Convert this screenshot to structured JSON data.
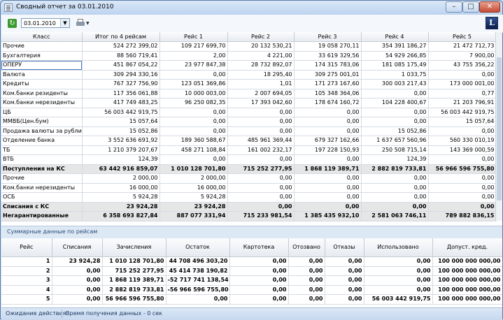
{
  "window": {
    "title": "Сводный отчет за  03.01.2010",
    "min_label": "–",
    "max_label": "□",
    "close_label": "✕"
  },
  "toolbar": {
    "date": "03.01.2010",
    "logo": "L"
  },
  "main": {
    "headers": [
      "Класс",
      "Итог по 4 рейсам",
      "Рейс 1",
      "Рейс 2",
      "Рейс 3",
      "Рейс 4",
      "Рейс 5"
    ],
    "rows": [
      {
        "c": [
          "Прочие",
          "524 272 399,02",
          "109 217 699,70",
          "20 132 530,21",
          "19 058 270,11",
          "354 391 186,27",
          "21 472 712,73"
        ]
      },
      {
        "c": [
          "Бухгалтерия",
          "88 560 719,41",
          "2,00",
          "4 221,00",
          "33 619 329,56",
          "54 929 266,85",
          "7 900,00"
        ]
      },
      {
        "c": [
          "ОПЕРУ",
          "451 867 054,22",
          "23 977 847,38",
          "28 732 892,07",
          "174 315 783,06",
          "181 085 175,49",
          "43 755 356,22"
        ],
        "sel": true
      },
      {
        "c": [
          "Валюта",
          "309 294 330,16",
          "0,00",
          "18 295,40",
          "309 275 001,01",
          "1 033,75",
          "0,00"
        ]
      },
      {
        "c": [
          "Кредиты",
          "767 327 756,90",
          "123 051 369,86",
          "1,01",
          "171 273 167,60",
          "300 003 217,43",
          "173 000 001,00"
        ]
      },
      {
        "c": [
          "Ком.банки резиденты",
          "117 356 061,88",
          "10 000 003,00",
          "2 007 694,05",
          "105 348 364,06",
          "0,00",
          "0,77"
        ]
      },
      {
        "c": [
          "Ком.банки нерезиденты",
          "417 749 483,25",
          "96 250 082,35",
          "17 393 042,60",
          "178 674 160,72",
          "104 228 400,67",
          "21 203 796,91"
        ]
      },
      {
        "c": [
          "ЦБ",
          "56 003 442 919,75",
          "0,00",
          "0,00",
          "0,00",
          "0,00",
          "56 003 442 919,75"
        ]
      },
      {
        "c": [
          "ММВБ(Цен.бум)",
          "15 057,64",
          "0,00",
          "0,00",
          "0,00",
          "0,00",
          "15 057,64"
        ]
      },
      {
        "c": [
          "Продажа валюты за рубли",
          "15 052,86",
          "0,00",
          "0,00",
          "0,00",
          "15 052,86",
          "0,00"
        ]
      },
      {
        "c": [
          "Отделение банка",
          "3 552 636 691,92",
          "189 360 588,67",
          "485 961 369,44",
          "679 327 162,66",
          "1 637 657 560,96",
          "560 330 010,19"
        ]
      },
      {
        "c": [
          "ТБ",
          "1 210 379 207,67",
          "458 271 108,84",
          "161 002 232,17",
          "197 228 150,93",
          "250 508 715,14",
          "143 369 000,59"
        ]
      },
      {
        "c": [
          "ВТБ",
          "124,39",
          "0,00",
          "0,00",
          "0,00",
          "124,39",
          "0,00"
        ]
      },
      {
        "c": [
          "Поступления на КС",
          "63 442 916 859,07",
          "1 010 128 701,80",
          "715 252 277,95",
          "1 868 119 389,71",
          "2 882 819 733,81",
          "56 966 596 755,80"
        ],
        "bold": true
      },
      {
        "c": [
          "Прочие",
          "2 000,00",
          "2 000,00",
          "0,00",
          "0,00",
          "0,00",
          "0,00"
        ]
      },
      {
        "c": [
          "Ком.банки нерезиденты",
          "16 000,00",
          "16 000,00",
          "0,00",
          "0,00",
          "0,00",
          "0,00"
        ]
      },
      {
        "c": [
          "ОСБ",
          "5 924,28",
          "5 924,28",
          "0,00",
          "0,00",
          "0,00",
          "0,00"
        ]
      },
      {
        "c": [
          "Списания с КС",
          "23 924,28",
          "23 924,28",
          "0,00",
          "0,00",
          "0,00",
          "0,00"
        ],
        "bold": true
      },
      {
        "c": [
          "Негарантированные",
          "6 358 693 827,84",
          "887 077 331,94",
          "715 233 981,54",
          "1 385 435 932,10",
          "2 581 063 746,11",
          "789 882 836,15"
        ],
        "bold": true
      }
    ]
  },
  "summary": {
    "title": "Суммарные данные по рейсам",
    "headers": [
      "Рейс",
      "Списания",
      "Зачисления",
      "Остаток",
      "Картотека",
      "Отозвано",
      "Отказы",
      "Использовано",
      "Допуст. кред."
    ],
    "rows": [
      [
        "1",
        "23 924,28",
        "1 010 128 701,80",
        "44 708 496 303,20",
        "0,00",
        "0,00",
        "0,00",
        "0,00",
        "100 000 000 000,00"
      ],
      [
        "2",
        "0,00",
        "715 252 277,95",
        "45 414 738 190,82",
        "0,00",
        "0,00",
        "0,00",
        "0,00",
        "100 000 000 000,00"
      ],
      [
        "3",
        "0,00",
        "1 868 119 389,71",
        "-52 717 741 138,54",
        "0,00",
        "0,00",
        "0,00",
        "0,00",
        "100 000 000 000,00"
      ],
      [
        "4",
        "0,00",
        "2 882 819 733,81",
        "-56 966 596 755,80",
        "0,00",
        "0,00",
        "0,00",
        "0,00",
        "100 000 000 000,00"
      ],
      [
        "5",
        "0,00",
        "56 966 596 755,80",
        "0,00",
        "0,00",
        "0,00",
        "0,00",
        "56 003 442 919,75",
        "100 000 000 000,00"
      ]
    ]
  },
  "status": {
    "left": "Ожидание действия",
    "right": "Время получения данных - 0 сек"
  }
}
